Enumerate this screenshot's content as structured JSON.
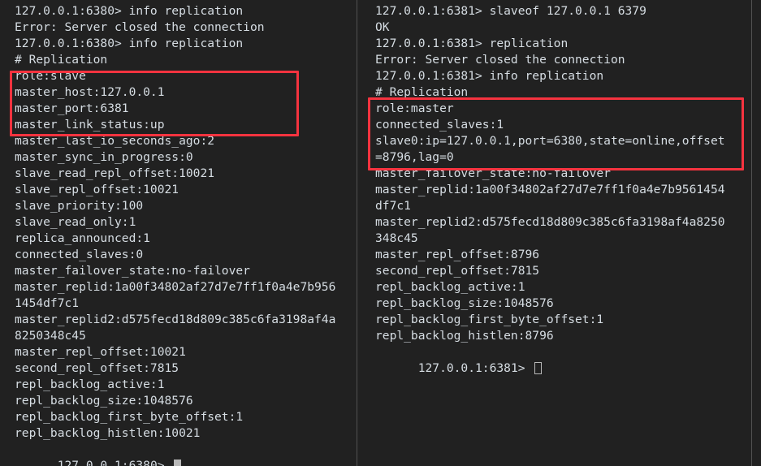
{
  "terminal": {
    "background_color": "#212121",
    "text_color": "#d6dde3",
    "highlight_color": "#f5333f",
    "divider_color": "#5a5a5a",
    "left_pane": {
      "name": "redis-cli-6380-slave",
      "cursor_style": "filled-block",
      "lines": [
        "127.0.0.1:6380> info replication",
        "Error: Server closed the connection",
        "127.0.0.1:6380> info replication",
        "# Replication",
        "role:slave",
        "master_host:127.0.0.1",
        "master_port:6381",
        "master_link_status:up",
        "master_last_io_seconds_ago:2",
        "master_sync_in_progress:0",
        "slave_read_repl_offset:10021",
        "slave_repl_offset:10021",
        "slave_priority:100",
        "slave_read_only:1",
        "replica_announced:1",
        "connected_slaves:0",
        "master_failover_state:no-failover",
        "master_replid:1a00f34802af27d7e7ff1f0a4e7b956",
        "1454df7c1",
        "master_replid2:d575fecd18d809c385c6fa3198af4a",
        "8250348c45",
        "master_repl_offset:10021",
        "second_repl_offset:7815",
        "repl_backlog_active:1",
        "repl_backlog_size:1048576",
        "repl_backlog_first_byte_offset:1",
        "repl_backlog_histlen:10021"
      ],
      "prompt": "127.0.0.1:6380> ",
      "highlight_label": "slave-role-highlight",
      "highlighted_lines": [
        "role:slave",
        "master_host:127.0.0.1",
        "master_port:6381",
        "master_link_status:up"
      ]
    },
    "right_pane": {
      "name": "redis-cli-6381-master",
      "cursor_style": "hollow-block",
      "lines": [
        "127.0.0.1:6381> slaveof 127.0.0.1 6379",
        "OK",
        "127.0.0.1:6381> replication",
        "Error: Server closed the connection",
        "127.0.0.1:6381> info replication",
        "# Replication",
        "role:master",
        "connected_slaves:1",
        "slave0:ip=127.0.0.1,port=6380,state=online,offset",
        "=8796,lag=0",
        "master_failover_state:no-failover",
        "master_replid:1a00f34802af27d7e7ff1f0a4e7b9561454",
        "df7c1",
        "master_replid2:d575fecd18d809c385c6fa3198af4a8250",
        "348c45",
        "master_repl_offset:8796",
        "second_repl_offset:7815",
        "repl_backlog_active:1",
        "repl_backlog_size:1048576",
        "repl_backlog_first_byte_offset:1",
        "repl_backlog_histlen:8796"
      ],
      "prompt": "127.0.0.1:6381> ",
      "highlight_label": "master-role-highlight",
      "highlighted_lines": [
        "role:master",
        "connected_slaves:1",
        "slave0:ip=127.0.0.1,port=6380,state=online,offset",
        "=8796,lag=0"
      ]
    }
  }
}
